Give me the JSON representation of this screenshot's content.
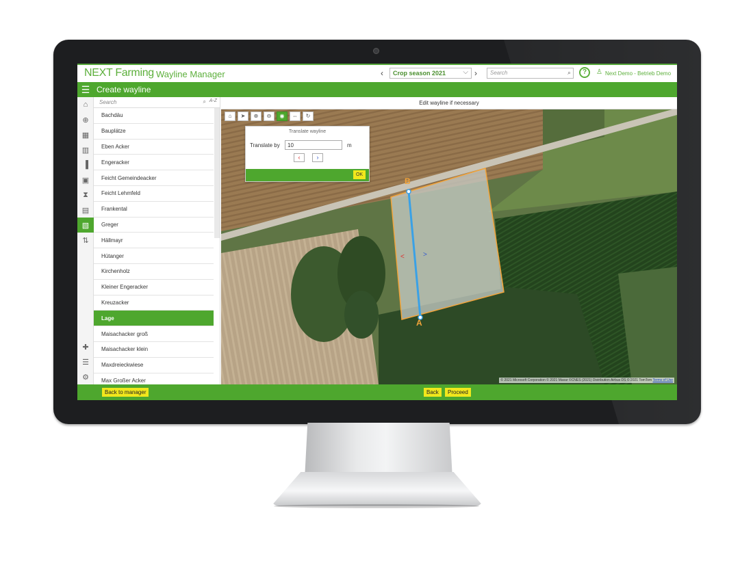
{
  "app": {
    "logo_text": "NEXT Farming",
    "name": "Wayline Manager",
    "crop_season": "Crop season 2021",
    "search_placeholder": "Search",
    "user": "Next Demo - Betrieb Demo",
    "accent_color": "#4ea72e",
    "button_color": "#f1e71c"
  },
  "page": {
    "title": "Create wayline"
  },
  "field_list": {
    "search_placeholder": "Search",
    "sort_label": "A-Z",
    "fields": [
      "Bachdäu",
      "Bauplätze",
      "Eben Acker",
      "Engeracker",
      "Feicht Gemeindeacker",
      "Feicht Lehmfeld",
      "Frankental",
      "Greger",
      "Hällmayr",
      "Hütanger",
      "Kirchenholz",
      "Kleiner Engeracker",
      "Kreuzacker",
      "Lage",
      "Maisachacker groß",
      "Maisachacker klein",
      "Maxdreieckwiese",
      "Max Großer Acker"
    ],
    "selected": "Lage"
  },
  "map": {
    "header": "Edit wayline if necessary",
    "translate_panel": {
      "title": "Translate wayline",
      "label": "Translate by",
      "value": "10",
      "unit": "m",
      "ok_label": "OK"
    },
    "point_a": "A",
    "point_b": "B",
    "attribution": "© 2021 Microsoft Corporation © 2021 Maxar ©CNES (2021) Distribution Airbus DS © 2021 TomTom",
    "terms_link": "Terms of Use"
  },
  "footer": {
    "back_to_manager": "Back to manager",
    "back": "Back",
    "proceed": "Proceed"
  }
}
